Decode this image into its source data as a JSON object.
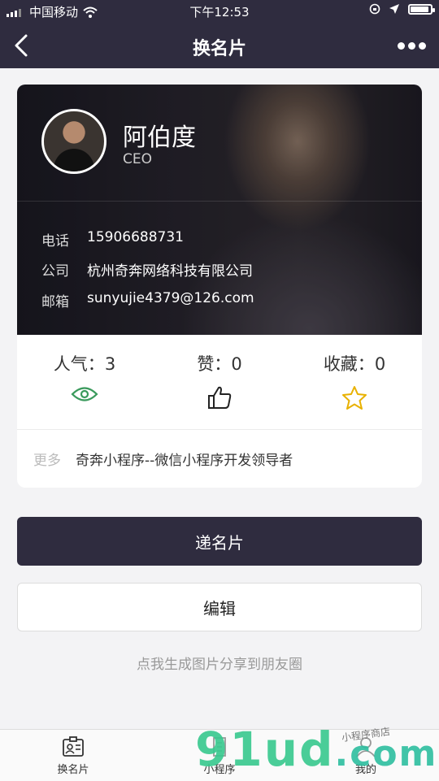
{
  "status_bar": {
    "carrier": "中国移动",
    "time": "下午12:53"
  },
  "nav": {
    "title": "换名片"
  },
  "card": {
    "name": "阿伯度",
    "position": "CEO",
    "info": [
      {
        "label": "电话",
        "value": "15906688731"
      },
      {
        "label": "公司",
        "value": "杭州奇奔网络科技有限公司"
      },
      {
        "label": "邮箱",
        "value": "sunyujie4379@126.com"
      }
    ],
    "stats": {
      "popularity": {
        "label": "人气：",
        "value": "3"
      },
      "likes": {
        "label": "赞：",
        "value": "0"
      },
      "favorites": {
        "label": "收藏：",
        "value": "0"
      }
    },
    "more": {
      "label": "更多",
      "value": "奇奔小程序--微信小程序开发领导者"
    }
  },
  "actions": {
    "send_card": "递名片",
    "edit": "编辑",
    "share_moments": "点我生成图片分享到朋友圈"
  },
  "tabbar": {
    "items": [
      {
        "label": "换名片"
      },
      {
        "label": "小程序"
      },
      {
        "label": "我的"
      }
    ]
  },
  "watermark": {
    "main": "91ud",
    "suffix": ".com",
    "tag": "小程序商店"
  },
  "colors": {
    "primary": "#2f2c3f",
    "eye_icon": "#3a9a5c",
    "star_icon": "#e8b100"
  }
}
